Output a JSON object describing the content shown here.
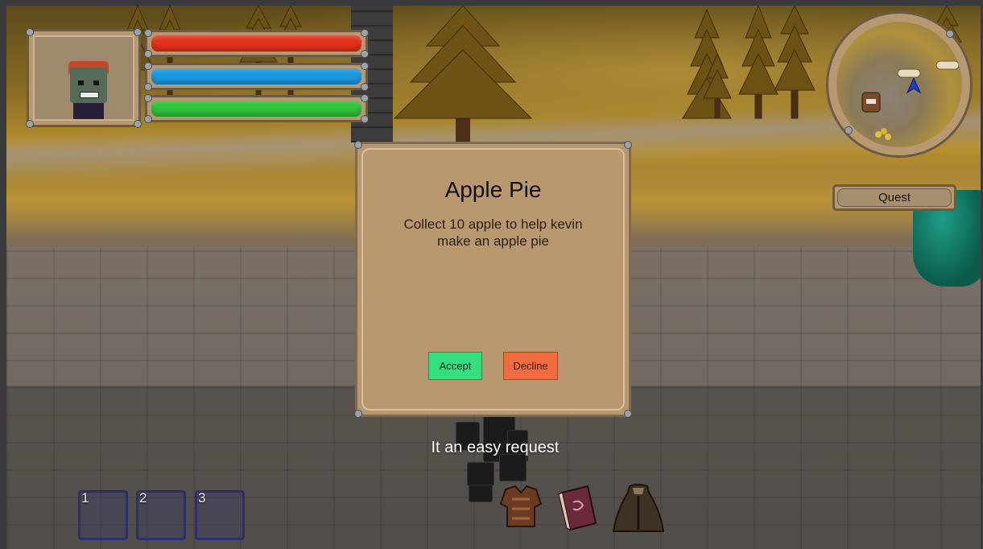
{
  "colors": {
    "health": "#e2321a",
    "mana": "#1b9ae0",
    "stamina": "#2fc23a",
    "accept": "#34e07e",
    "decline": "#f26a40",
    "panel": "#b89870"
  },
  "hud": {
    "bars": [
      {
        "name": "health",
        "fill_fraction": 1.0
      },
      {
        "name": "mana",
        "fill_fraction": 1.0
      },
      {
        "name": "stamina",
        "fill_fraction": 1.0
      }
    ],
    "quest_button_label": "Quest"
  },
  "dialog": {
    "title": "Apple Pie",
    "body": "Collect 10 apple to help kevin make an apple pie",
    "accept_label": "Accept",
    "decline_label": "Decline"
  },
  "subtitle": "It an easy request",
  "hotbar": {
    "slots": [
      {
        "number": "1"
      },
      {
        "number": "2"
      },
      {
        "number": "3"
      }
    ]
  },
  "equipment_icons": [
    "armor-icon",
    "spellbook-icon",
    "cloak-icon"
  ],
  "minimap_icons": [
    "player-arrow-icon",
    "scroll-marker-icon",
    "npc-marker-icon",
    "coins-marker-icon"
  ]
}
